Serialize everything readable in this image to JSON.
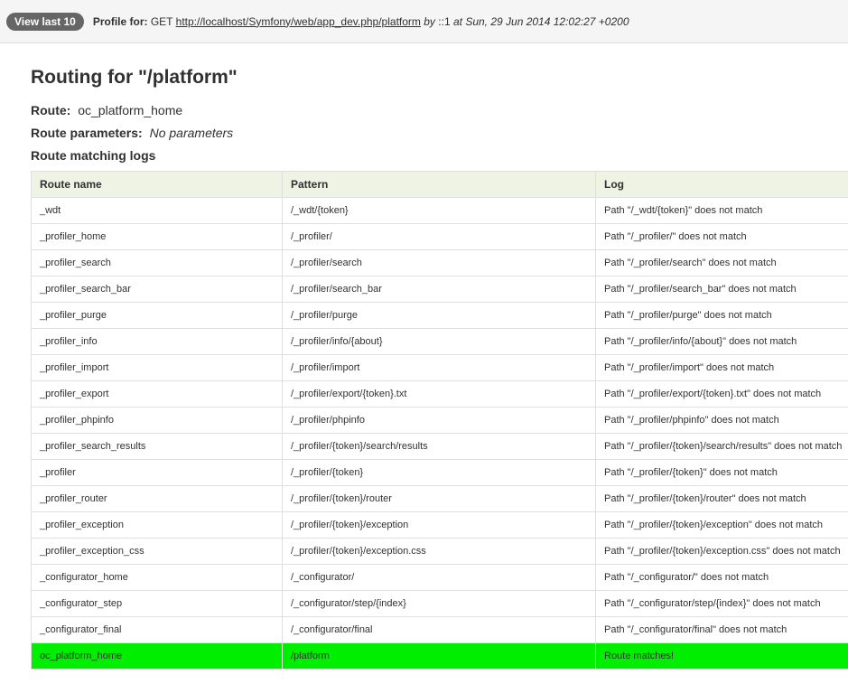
{
  "toolbar": {
    "view_last_label": "View last 10",
    "profile_for_label": "Profile for:",
    "method": "GET",
    "url": "http://localhost/Symfony/web/app_dev.php/platform",
    "by_text": "by",
    "ip": "::1",
    "at_text": "at",
    "datetime": "Sun, 29 Jun 2014 12:02:27 +0200"
  },
  "page": {
    "title": "Routing for \"/platform\"",
    "route_label": "Route:",
    "route_value": "oc_platform_home",
    "params_label": "Route parameters:",
    "params_value": "No parameters",
    "logs_heading": "Route matching logs"
  },
  "table": {
    "headers": [
      "Route name",
      "Pattern",
      "Log"
    ],
    "rows": [
      {
        "name": "_wdt",
        "pattern": "/_wdt/{token}",
        "log": "Path \"/_wdt/{token}\" does not match"
      },
      {
        "name": "_profiler_home",
        "pattern": "/_profiler/",
        "log": "Path \"/_profiler/\" does not match"
      },
      {
        "name": "_profiler_search",
        "pattern": "/_profiler/search",
        "log": "Path \"/_profiler/search\" does not match"
      },
      {
        "name": "_profiler_search_bar",
        "pattern": "/_profiler/search_bar",
        "log": "Path \"/_profiler/search_bar\" does not match"
      },
      {
        "name": "_profiler_purge",
        "pattern": "/_profiler/purge",
        "log": "Path \"/_profiler/purge\" does not match"
      },
      {
        "name": "_profiler_info",
        "pattern": "/_profiler/info/{about}",
        "log": "Path \"/_profiler/info/{about}\" does not match"
      },
      {
        "name": "_profiler_import",
        "pattern": "/_profiler/import",
        "log": "Path \"/_profiler/import\" does not match"
      },
      {
        "name": "_profiler_export",
        "pattern": "/_profiler/export/{token}.txt",
        "log": "Path \"/_profiler/export/{token}.txt\" does not match"
      },
      {
        "name": "_profiler_phpinfo",
        "pattern": "/_profiler/phpinfo",
        "log": "Path \"/_profiler/phpinfo\" does not match"
      },
      {
        "name": "_profiler_search_results",
        "pattern": "/_profiler/{token}/search/results",
        "log": "Path \"/_profiler/{token}/search/results\" does not match"
      },
      {
        "name": "_profiler",
        "pattern": "/_profiler/{token}",
        "log": "Path \"/_profiler/{token}\" does not match"
      },
      {
        "name": "_profiler_router",
        "pattern": "/_profiler/{token}/router",
        "log": "Path \"/_profiler/{token}/router\" does not match"
      },
      {
        "name": "_profiler_exception",
        "pattern": "/_profiler/{token}/exception",
        "log": "Path \"/_profiler/{token}/exception\" does not match"
      },
      {
        "name": "_profiler_exception_css",
        "pattern": "/_profiler/{token}/exception.css",
        "log": "Path \"/_profiler/{token}/exception.css\" does not match"
      },
      {
        "name": "_configurator_home",
        "pattern": "/_configurator/",
        "log": "Path \"/_configurator/\" does not match"
      },
      {
        "name": "_configurator_step",
        "pattern": "/_configurator/step/{index}",
        "log": "Path \"/_configurator/step/{index}\" does not match"
      },
      {
        "name": "_configurator_final",
        "pattern": "/_configurator/final",
        "log": "Path \"/_configurator/final\" does not match"
      },
      {
        "name": "oc_platform_home",
        "pattern": "/platform",
        "log": "Route matches!",
        "matched": true
      }
    ]
  },
  "colors": {
    "match_row": "#00ee00",
    "header_bg": "#eff3e4",
    "badge_bg": "#666666"
  }
}
